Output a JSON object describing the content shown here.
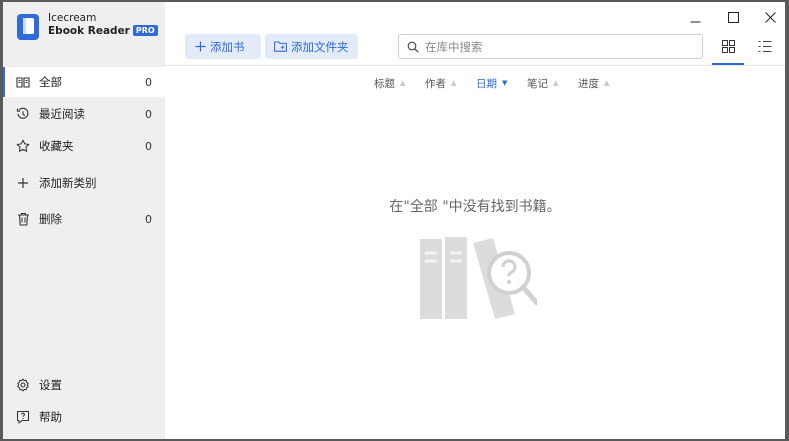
{
  "app": {
    "name_line1": "Icecream",
    "name_line2": "Ebook Reader",
    "badge": "PRO",
    "accent_color": "#2f6bd8"
  },
  "sidebar": {
    "items": [
      {
        "label": "全部",
        "count": "0",
        "icon": "book-open-icon",
        "active": true
      },
      {
        "label": "最近阅读",
        "count": "0",
        "icon": "history-icon"
      },
      {
        "label": "收藏夹",
        "count": "0",
        "icon": "star-icon"
      },
      {
        "label": "添加新类别",
        "icon": "plus-icon"
      },
      {
        "label": "删除",
        "count": "0",
        "icon": "trash-icon"
      }
    ],
    "settings_label": "设置",
    "help_label": "帮助"
  },
  "toolbar": {
    "add_book_label": "添加书",
    "add_folder_label": "添加文件夹",
    "search_placeholder": "在库中搜索"
  },
  "sort_bar": {
    "items": [
      {
        "label": "标题",
        "active": false
      },
      {
        "label": "作者",
        "active": false
      },
      {
        "label": "日期",
        "active": true
      },
      {
        "label": "笔记",
        "active": false
      },
      {
        "label": "进度",
        "active": false
      }
    ]
  },
  "main": {
    "empty_message": "在\"全部 \"中没有找到书籍。"
  }
}
